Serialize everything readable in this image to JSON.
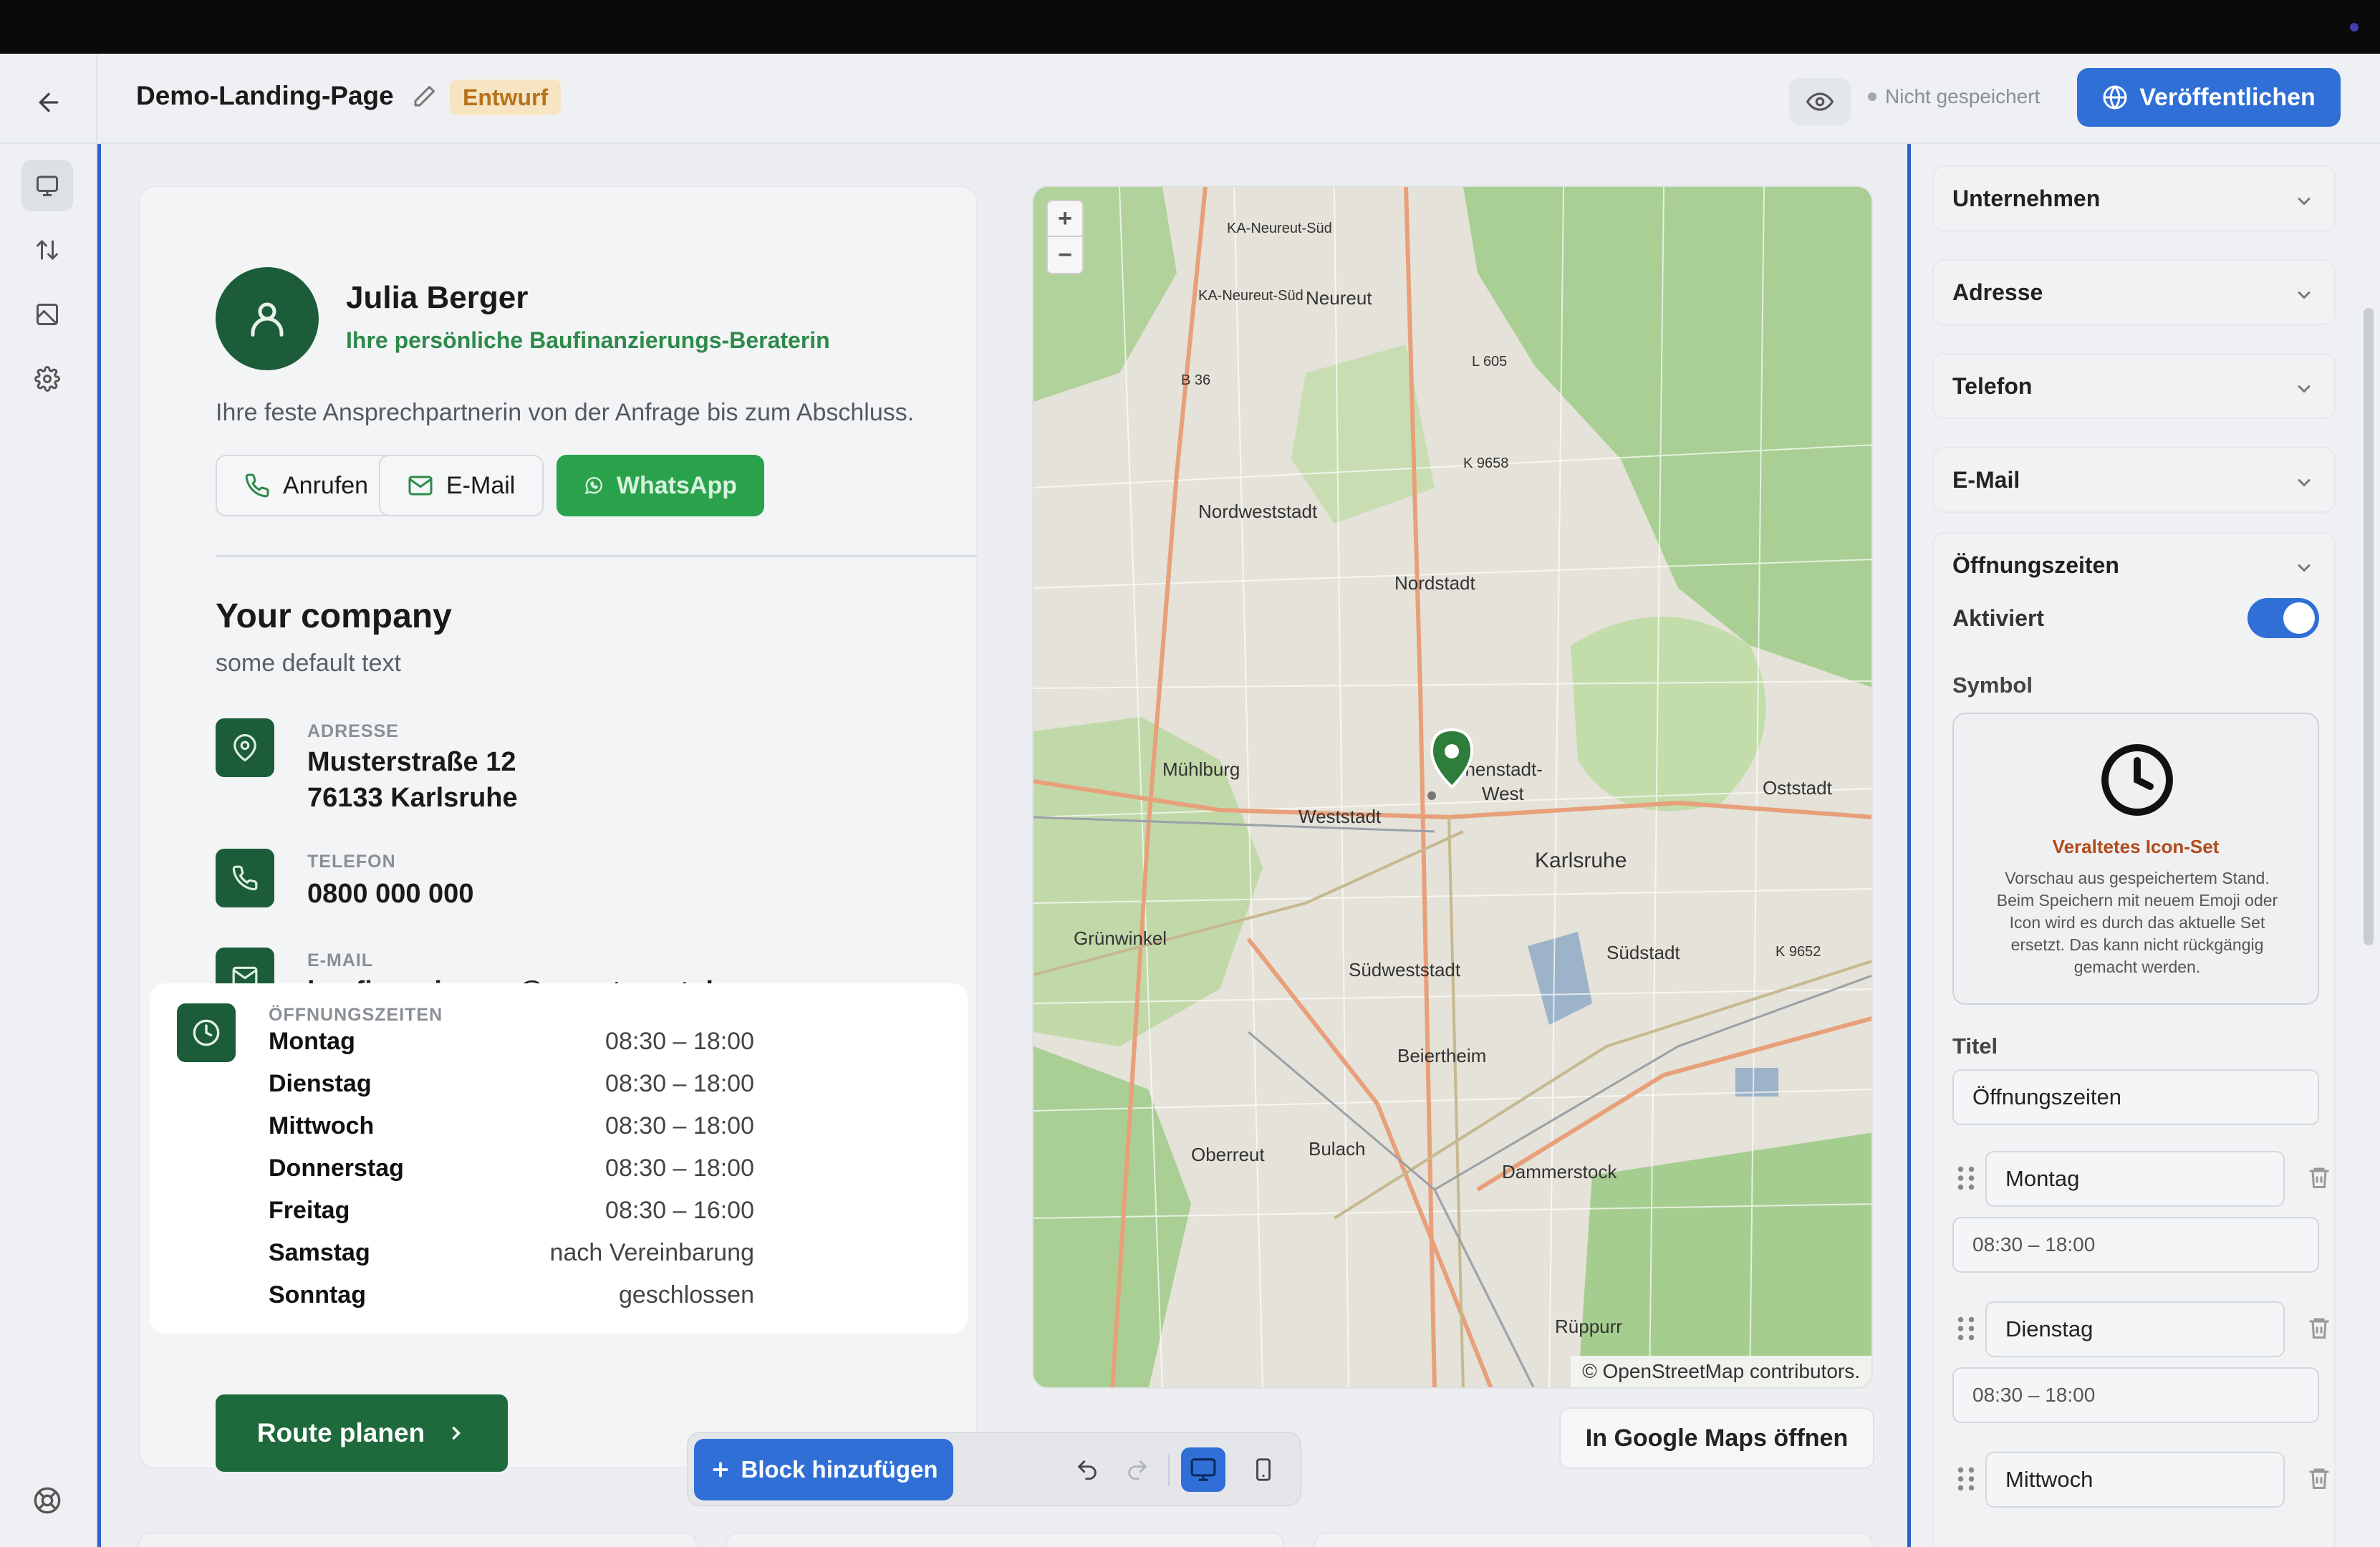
{
  "header": {
    "title": "Demo-Landing-Page",
    "status_badge": "Entwurf",
    "save_status": "Nicht gespeichert",
    "publish_label": "Veröffentlichen"
  },
  "profile": {
    "name": "Julia Berger",
    "role": "Ihre persönliche Baufinanzierungs-Beraterin",
    "description": "Ihre feste Ansprechpartnerin von der Anfrage bis zum Abschluss.",
    "call_label": "Anrufen",
    "email_label": "E-Mail",
    "whatsapp_label": "WhatsApp"
  },
  "company": {
    "name": "Your company",
    "subtitle": "some default text",
    "address_label": "ADRESSE",
    "address_line1": "Musterstraße 12",
    "address_line2": "76133 Karlsruhe",
    "phone_label": "TELEFON",
    "phone_value": "0800 000 000",
    "email_label": "E-MAIL",
    "email_value": "baufinanzierung@wuestenrot.de"
  },
  "hours": {
    "label": "ÖFFNUNGSZEITEN",
    "rows": [
      {
        "day": "Montag",
        "time": "08:30 – 18:00"
      },
      {
        "day": "Dienstag",
        "time": "08:30 – 18:00"
      },
      {
        "day": "Mittwoch",
        "time": "08:30 – 18:00"
      },
      {
        "day": "Donnerstag",
        "time": "08:30 – 18:00"
      },
      {
        "day": "Freitag",
        "time": "08:30 – 16:00"
      },
      {
        "day": "Samstag",
        "time": "nach Vereinbarung"
      },
      {
        "day": "Sonntag",
        "time": "geschlossen"
      }
    ]
  },
  "route_label": "Route planen",
  "map": {
    "zoom_in": "+",
    "zoom_out": "−",
    "attribution": "© OpenStreetMap contributors.",
    "labels": {
      "neureut_sued": "KA-Neureut-Süd",
      "neureut_sued2": "KA-Neureut-Süd",
      "neureut": "Neureut",
      "b36": "B 36",
      "l605": "L 605",
      "k9658": "K 9658",
      "nordweststadt": "Nordweststadt",
      "nordstadt": "Nordstadt",
      "muehlburg": "Mühlburg",
      "innenstadt": "nnenstadt-",
      "west": "West",
      "weststadt": "Weststadt",
      "oststadt": "Oststadt",
      "karlsruhe": "Karlsruhe",
      "gruenwinkel": "Grünwinkel",
      "suedweststadt": "Südweststadt",
      "suedstadt": "Südstadt",
      "k9652": "K 9652",
      "beiertheim": "Beiertheim",
      "oberreut": "Oberreut",
      "bulach": "Bulach",
      "dammerstock": "Dammerstock",
      "rueppurr": "Rüppurr"
    }
  },
  "gmaps_label": "In Google Maps öffnen",
  "toolbar": {
    "add_block_label": "Block hinzufügen"
  },
  "panel": {
    "sections": [
      "Unternehmen",
      "Adresse",
      "Telefon",
      "E-Mail"
    ],
    "open_section": "Öffnungszeiten",
    "aktiviert_label": "Aktiviert",
    "symbol_label": "Symbol",
    "symbol_warn_title": "Veraltetes Icon-Set",
    "symbol_warn_text": "Vorschau aus gespeichertem Stand. Beim Speichern mit neuem Emoji oder Icon wird es durch das aktuelle Set ersetzt. Das kann nicht rückgängig gemacht werden.",
    "titel_label": "Titel",
    "titel_value": "Öffnungszeiten",
    "days": [
      {
        "day": "Montag",
        "time": "08:30 – 18:00"
      },
      {
        "day": "Dienstag",
        "time": "08:30 – 18:00"
      },
      {
        "day": "Mittwoch"
      }
    ]
  },
  "colors": {
    "primary_blue": "#2f6fd6",
    "brand_green": "#1d5c39",
    "whatsapp_green": "#2aa24b",
    "draft_orange": "#b7721a"
  }
}
